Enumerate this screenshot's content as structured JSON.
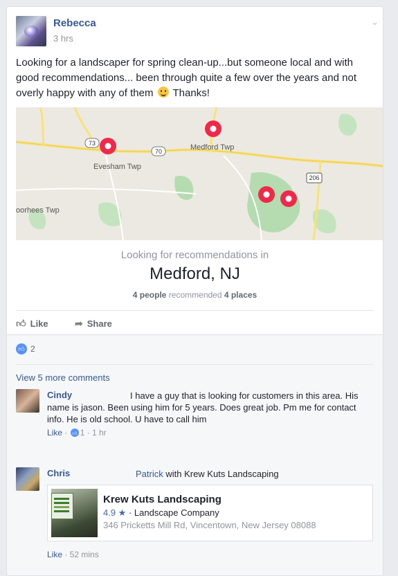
{
  "post": {
    "author": "Rebecca",
    "time": "3 hrs",
    "text_before_emoji": "Looking for a landscaper for spring clean-up...but someone local and with good recommendations... been through quite a few over the years and not overly happy with any of them ",
    "text_after_emoji": " Thanks!"
  },
  "map": {
    "labels": [
      "Evesham Twp",
      "Medford Twp",
      "oorhees Twp"
    ],
    "route_shields": [
      "73",
      "70",
      "206"
    ],
    "pin_color": "#f02849",
    "pin_count": 4
  },
  "recommendation": {
    "header": "Looking for recommendations in",
    "city": "Medford, NJ",
    "people_count": "4 people",
    "middle_text": " recommended ",
    "places_count": "4 places"
  },
  "actions": {
    "like": "Like",
    "share": "Share"
  },
  "reactions": {
    "count": "2"
  },
  "comments": {
    "view_more": "View 5 more comments",
    "items": [
      {
        "name": "Cindy",
        "text": "I have a guy that is looking for customers in this area. His name is jason. Been using him for 5 years. Does great job. Pm me for contact info. He is old school. U have to call him",
        "like_label": "Like",
        "like_count": "1",
        "time": "1 hr"
      },
      {
        "name": "Chris",
        "mention": "Patrick",
        "text": " with Krew Kuts Landscaping",
        "like_label": "Like",
        "time": "52 mins"
      }
    ]
  },
  "place_card": {
    "name": "Krew Kuts Landscaping",
    "rating": "4.9 ★",
    "category": " · Landscape Company",
    "address": "346 Pricketts Mill Rd, Vincentown, New Jersey 08088"
  },
  "colors": {
    "link": "#365899",
    "brand_blue": "#5890ff",
    "map_green": "#b5dcb0",
    "road_yellow": "#f9e27a"
  }
}
